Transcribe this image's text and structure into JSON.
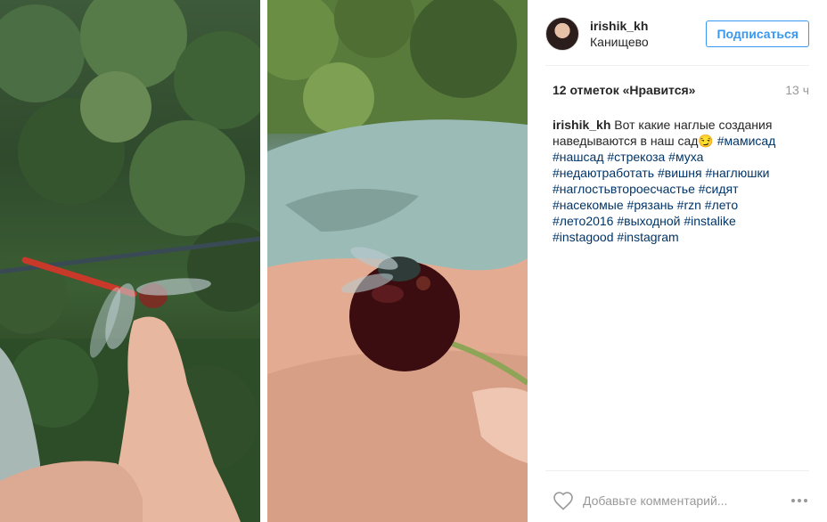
{
  "post": {
    "username": "irishik_kh",
    "location": "Канищево",
    "follow_label": "Подписаться",
    "likes": "12 отметок «Нравится»",
    "time": "13 ч",
    "caption_user": "irishik_kh",
    "caption_text": "Вот какие наглые создания наведываются в наш сад😏",
    "hashtags": [
      "#мамисад",
      "#нашсад",
      "#стрекоза",
      "#муха",
      "#недаютработать",
      "#вишня",
      "#наглюшки",
      "#наглостьвтороесчастье",
      "#сидят",
      "#насекомые",
      "#рязань",
      "#rzn",
      "#лето",
      "#лето2016",
      "#выходной",
      "#instalike",
      "#instagood",
      "#instagram"
    ],
    "comment_placeholder": "Добавьте комментарий..."
  },
  "colors": {
    "accent": "#3897f0",
    "hashtag": "#003569",
    "muted": "#999999"
  },
  "icons": {
    "like": "heart-icon",
    "options": "more-options-icon"
  }
}
